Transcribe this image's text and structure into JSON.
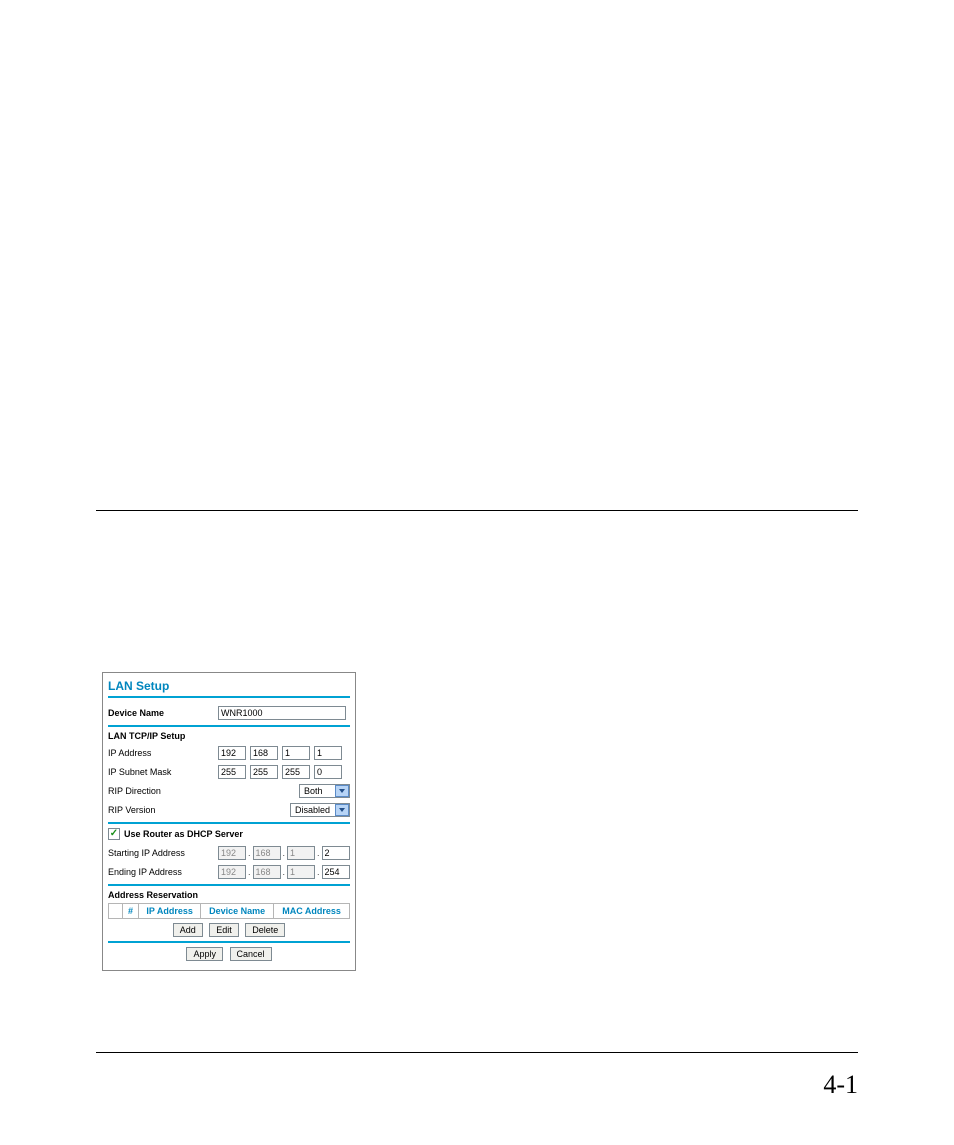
{
  "page": {
    "number": "4-1"
  },
  "panel": {
    "title": "LAN Setup",
    "deviceName": {
      "label": "Device Name",
      "value": "WNR1000"
    },
    "tcpip": {
      "heading": "LAN TCP/IP Setup",
      "ipAddress": {
        "label": "IP Address",
        "octets": [
          "192",
          "168",
          "1",
          "1"
        ]
      },
      "subnetMask": {
        "label": "IP Subnet Mask",
        "octets": [
          "255",
          "255",
          "255",
          "0"
        ]
      },
      "ripDirection": {
        "label": "RIP Direction",
        "value": "Both"
      },
      "ripVersion": {
        "label": "RIP Version",
        "value": "Disabled"
      }
    },
    "dhcp": {
      "checkboxLabel": "Use Router as DHCP Server",
      "checked": true,
      "startingIp": {
        "label": "Starting IP Address",
        "octets": [
          "192",
          "168",
          "1",
          "2"
        ]
      },
      "endingIp": {
        "label": "Ending IP Address",
        "octets": [
          "192",
          "168",
          "1",
          "254"
        ]
      }
    },
    "addressReservation": {
      "heading": "Address Reservation",
      "columns": {
        "hash": "#",
        "ip": "IP Address",
        "device": "Device Name",
        "mac": "MAC Address"
      },
      "buttons": {
        "add": "Add",
        "edit": "Edit",
        "delete": "Delete"
      }
    },
    "footerButtons": {
      "apply": "Apply",
      "cancel": "Cancel"
    }
  }
}
